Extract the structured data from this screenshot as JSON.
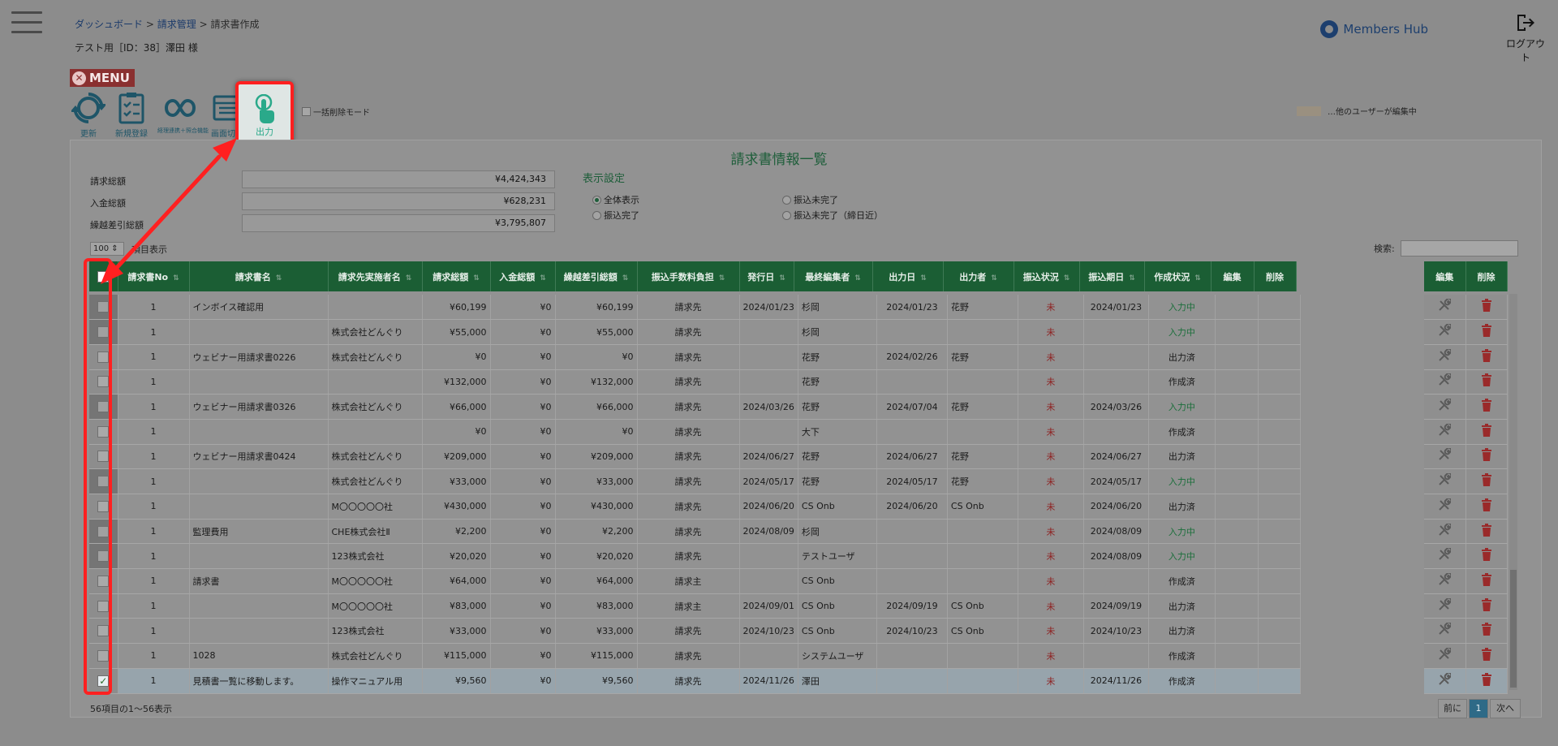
{
  "breadcrumb": {
    "items": [
      "ダッシュボード",
      "請求管理",
      "請求書作成"
    ],
    "sep": ">"
  },
  "user_line": "テスト用［ID：38］澤田 様",
  "brand": "Members Hub",
  "logout_label": "ログアウト",
  "menu_label": "MENU",
  "toolbar": {
    "refresh": "更新",
    "new": "新規登録",
    "link": "経理連携＋照合機能",
    "switch": "画面切替",
    "output": "出力"
  },
  "bulk_delete_label": "一括削除モード",
  "legend_label": "…他のユーザーが編集中",
  "panel_title": "請求書情報一覧",
  "summary": [
    {
      "label": "請求総額",
      "value": "¥4,424,343"
    },
    {
      "label": "入金総額",
      "value": "¥628,231"
    },
    {
      "label": "繰越差引総額",
      "value": "¥3,795,807"
    }
  ],
  "display_settings": {
    "title": "表示設定",
    "options": [
      "全体表示",
      "振込完了",
      "振込未完了",
      "振込未完了（締日近）"
    ],
    "selected": "全体表示"
  },
  "page_size": "100",
  "page_size_suffix": "項目表示",
  "search_label": "検索:",
  "columns": [
    "請求書No",
    "請求書名",
    "請求先実施者名",
    "請求総額",
    "入金総額",
    "繰越差引総額",
    "振込手数料負担",
    "発行日",
    "最終編集者",
    "出力日",
    "出力者",
    "振込状況",
    "振込期日",
    "作成状況",
    "編集",
    "削除"
  ],
  "fixed_columns": [
    "編集",
    "削除"
  ],
  "rows": [
    {
      "no": "1",
      "name": "インボイス確認用",
      "client": "",
      "total": "¥60,199",
      "paid": "¥0",
      "balance": "¥60,199",
      "fee": "請求先",
      "issued": "2024/01/23",
      "editor": "杉岡",
      "outdate": "2024/01/23",
      "outby": "花野",
      "status": "未",
      "due": "2024/01/23",
      "state": "入力中",
      "dark": true
    },
    {
      "no": "1",
      "name": "",
      "client": "株式会社どんぐり",
      "total": "¥55,000",
      "paid": "¥0",
      "balance": "¥55,000",
      "fee": "請求先",
      "issued": "",
      "editor": "杉岡",
      "outdate": "",
      "outby": "",
      "status": "未",
      "due": "",
      "state": "入力中",
      "dark": true
    },
    {
      "no": "1",
      "name": "ウェビナー用請求書0226",
      "client": "株式会社どんぐり",
      "total": "¥0",
      "paid": "¥0",
      "balance": "¥0",
      "fee": "請求先",
      "issued": "",
      "editor": "花野",
      "outdate": "2024/02/26",
      "outby": "花野",
      "status": "未",
      "due": "",
      "state": "出力済",
      "dark": false
    },
    {
      "no": "1",
      "name": "",
      "client": "",
      "total": "¥132,000",
      "paid": "¥0",
      "balance": "¥132,000",
      "fee": "請求先",
      "issued": "",
      "editor": "花野",
      "outdate": "",
      "outby": "",
      "status": "未",
      "due": "",
      "state": "作成済",
      "dark": false
    },
    {
      "no": "1",
      "name": "ウェビナー用請求書0326",
      "client": "株式会社どんぐり",
      "total": "¥66,000",
      "paid": "¥0",
      "balance": "¥66,000",
      "fee": "請求先",
      "issued": "2024/03/26",
      "editor": "花野",
      "outdate": "2024/07/04",
      "outby": "花野",
      "status": "未",
      "due": "2024/03/26",
      "state": "入力中",
      "dark": true
    },
    {
      "no": "1",
      "name": "",
      "client": "",
      "total": "¥0",
      "paid": "¥0",
      "balance": "¥0",
      "fee": "請求先",
      "issued": "",
      "editor": "大下",
      "outdate": "",
      "outby": "",
      "status": "未",
      "due": "",
      "state": "作成済",
      "dark": false
    },
    {
      "no": "1",
      "name": "ウェビナー用請求書0424",
      "client": "株式会社どんぐり",
      "total": "¥209,000",
      "paid": "¥0",
      "balance": "¥209,000",
      "fee": "請求先",
      "issued": "2024/06/27",
      "editor": "花野",
      "outdate": "2024/06/27",
      "outby": "花野",
      "status": "未",
      "due": "2024/06/27",
      "state": "出力済",
      "dark": false
    },
    {
      "no": "1",
      "name": "",
      "client": "株式会社どんぐり",
      "total": "¥33,000",
      "paid": "¥0",
      "balance": "¥33,000",
      "fee": "請求先",
      "issued": "2024/05/17",
      "editor": "花野",
      "outdate": "2024/05/17",
      "outby": "花野",
      "status": "未",
      "due": "2024/05/17",
      "state": "入力中",
      "dark": true
    },
    {
      "no": "1",
      "name": "",
      "client": "M〇〇〇〇〇社",
      "total": "¥430,000",
      "paid": "¥0",
      "balance": "¥430,000",
      "fee": "請求先",
      "issued": "2024/06/20",
      "editor": "CS Onb",
      "outdate": "2024/06/20",
      "outby": "CS Onb",
      "status": "未",
      "due": "2024/06/20",
      "state": "出力済",
      "dark": false
    },
    {
      "no": "1",
      "name": "監理費用",
      "client": "CHE株式会社Ⅱ",
      "total": "¥2,200",
      "paid": "¥0",
      "balance": "¥2,200",
      "fee": "請求先",
      "issued": "2024/08/09",
      "editor": "杉岡",
      "outdate": "",
      "outby": "",
      "status": "未",
      "due": "2024/08/09",
      "state": "入力中",
      "dark": true
    },
    {
      "no": "1",
      "name": "",
      "client": "123株式会社",
      "total": "¥20,020",
      "paid": "¥0",
      "balance": "¥20,020",
      "fee": "請求先",
      "issued": "",
      "editor": "テストユーザ",
      "outdate": "",
      "outby": "",
      "status": "未",
      "due": "2024/08/09",
      "state": "入力中",
      "dark": true
    },
    {
      "no": "1",
      "name": "請求書",
      "client": "M〇〇〇〇〇社",
      "total": "¥64,000",
      "paid": "¥0",
      "balance": "¥64,000",
      "fee": "請求主",
      "issued": "",
      "editor": "CS Onb",
      "outdate": "",
      "outby": "",
      "status": "未",
      "due": "",
      "state": "作成済",
      "dark": false
    },
    {
      "no": "1",
      "name": "",
      "client": "M〇〇〇〇〇社",
      "total": "¥83,000",
      "paid": "¥0",
      "balance": "¥83,000",
      "fee": "請求主",
      "issued": "2024/09/01",
      "editor": "CS Onb",
      "outdate": "2024/09/19",
      "outby": "CS Onb",
      "status": "未",
      "due": "2024/09/19",
      "state": "出力済",
      "dark": false
    },
    {
      "no": "1",
      "name": "",
      "client": "123株式会社",
      "total": "¥33,000",
      "paid": "¥0",
      "balance": "¥33,000",
      "fee": "請求先",
      "issued": "2024/10/23",
      "editor": "CS Onb",
      "outdate": "2024/10/23",
      "outby": "CS Onb",
      "status": "未",
      "due": "2024/10/23",
      "state": "出力済",
      "dark": false
    },
    {
      "no": "1",
      "name": "1028",
      "client": "株式会社どんぐり",
      "total": "¥115,000",
      "paid": "¥0",
      "balance": "¥115,000",
      "fee": "請求先",
      "issued": "",
      "editor": "システムユーザ",
      "outdate": "",
      "outby": "",
      "status": "未",
      "due": "",
      "state": "作成済",
      "dark": false
    },
    {
      "no": "1",
      "name": "見積書一覧に移動します。",
      "client": "操作マニュアル用",
      "total": "¥9,560",
      "paid": "¥0",
      "balance": "¥9,560",
      "fee": "請求先",
      "issued": "2024/11/26",
      "editor": "澤田",
      "outdate": "",
      "outby": "",
      "status": "未",
      "due": "2024/11/26",
      "state": "作成済",
      "dark": false,
      "selected": true
    }
  ],
  "footer_info": "56項目の1～56表示",
  "pagination": {
    "prev": "前に",
    "current": "1",
    "next": "次へ"
  },
  "colors": {
    "header_green": "#1b5e34",
    "highlight_red": "#ff2020",
    "output_icon": "#2aa98a"
  }
}
